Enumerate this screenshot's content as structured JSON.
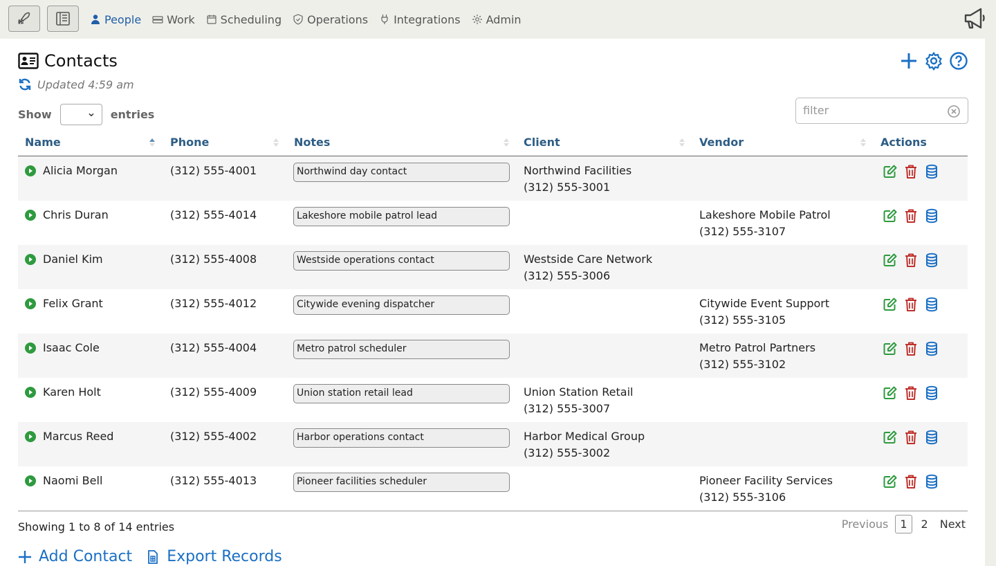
{
  "nav": {
    "items": [
      {
        "label": "People",
        "icon": "person-icon",
        "active": true
      },
      {
        "label": "Work",
        "icon": "work-icon",
        "active": false
      },
      {
        "label": "Scheduling",
        "icon": "calendar-icon",
        "active": false
      },
      {
        "label": "Operations",
        "icon": "shield-icon",
        "active": false
      },
      {
        "label": "Integrations",
        "icon": "plug-icon",
        "active": false
      },
      {
        "label": "Admin",
        "icon": "gear-icon",
        "active": false
      }
    ]
  },
  "page": {
    "title": "Contacts",
    "updated": "Updated 4:59 am"
  },
  "controls": {
    "show_label": "Show",
    "entries_label": "entries",
    "filter_placeholder": "filter"
  },
  "table": {
    "columns": [
      "Name",
      "Phone",
      "Notes",
      "Client",
      "Vendor",
      "Actions"
    ],
    "rows": [
      {
        "name": "Alicia Morgan",
        "phone": "(312) 555-4001",
        "note": "Northwind day contact",
        "client": "Northwind Facilities",
        "client_phone": "(312) 555-3001",
        "vendor": "",
        "vendor_phone": ""
      },
      {
        "name": "Chris Duran",
        "phone": "(312) 555-4014",
        "note": "Lakeshore mobile patrol lead",
        "client": "",
        "client_phone": "",
        "vendor": "Lakeshore Mobile Patrol",
        "vendor_phone": "(312) 555-3107"
      },
      {
        "name": "Daniel Kim",
        "phone": "(312) 555-4008",
        "note": "Westside operations contact",
        "client": "Westside Care Network",
        "client_phone": "(312) 555-3006",
        "vendor": "",
        "vendor_phone": ""
      },
      {
        "name": "Felix Grant",
        "phone": "(312) 555-4012",
        "note": "Citywide evening dispatcher",
        "client": "",
        "client_phone": "",
        "vendor": "Citywide Event Support",
        "vendor_phone": "(312) 555-3105"
      },
      {
        "name": "Isaac Cole",
        "phone": "(312) 555-4004",
        "note": "Metro patrol scheduler",
        "client": "",
        "client_phone": "",
        "vendor": "Metro Patrol Partners",
        "vendor_phone": "(312) 555-3102"
      },
      {
        "name": "Karen Holt",
        "phone": "(312) 555-4009",
        "note": "Union station retail lead",
        "client": "Union Station Retail",
        "client_phone": "(312) 555-3007",
        "vendor": "",
        "vendor_phone": ""
      },
      {
        "name": "Marcus Reed",
        "phone": "(312) 555-4002",
        "note": "Harbor operations contact",
        "client": "Harbor Medical Group",
        "client_phone": "(312) 555-3002",
        "vendor": "",
        "vendor_phone": ""
      },
      {
        "name": "Naomi Bell",
        "phone": "(312) 555-4013",
        "note": "Pioneer facilities scheduler",
        "client": "",
        "client_phone": "",
        "vendor": "Pioneer Facility Services",
        "vendor_phone": "(312) 555-3106"
      }
    ]
  },
  "footer": {
    "info": "Showing 1 to 8 of 14 entries",
    "previous": "Previous",
    "pages": [
      "1",
      "2"
    ],
    "current_page": "1",
    "next": "Next"
  },
  "links": {
    "add": "Add Contact",
    "export": "Export Records"
  },
  "colors": {
    "accent": "#1a6fc4",
    "edit": "#2e9a3e",
    "delete": "#c0302b",
    "status": "#2e9a3e"
  }
}
